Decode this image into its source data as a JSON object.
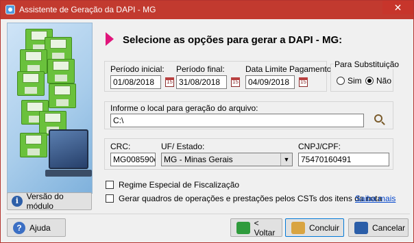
{
  "window": {
    "title": "Assistente de Geração da DAPI - MG",
    "close_symbol": "✕"
  },
  "heading": "Selecione as opções para gerar a DAPI - MG:",
  "periodo": {
    "inicial_label": "Período inicial:",
    "inicial_value": "01/08/2018",
    "final_label": "Período final:",
    "final_value": "31/08/2018",
    "limite_label": "Data Limite Pagamento:",
    "limite_value": "04/09/2018"
  },
  "substituicao": {
    "legend": "Para Substituição",
    "options": [
      {
        "label": "Sim",
        "checked": false
      },
      {
        "label": "Não",
        "checked": true
      }
    ]
  },
  "arquivo": {
    "label": "Informe o local para geração do arquivo:",
    "value": "C:\\"
  },
  "empresa": {
    "crc_label": "CRC:",
    "crc_value": "MG008590o",
    "uf_label": "UF/ Estado:",
    "uf_value": "MG - Minas Gerais",
    "cnpj_label": "CNPJ/CPF:",
    "cnpj_value": "75470160491"
  },
  "checks": [
    {
      "label": "Regime Especial de Fiscalização",
      "checked": false
    },
    {
      "label": "Gerar quadros de operações e prestações pelos CSTs dos itens da nota",
      "checked": false
    }
  ],
  "saiba_mais": "Saiba mais",
  "buttons": {
    "versao": "Versão do módulo",
    "ajuda": "Ajuda",
    "voltar": "< Voltar",
    "concluir": "Concluir",
    "cancelar": "Cancelar"
  },
  "colors": {
    "titlebar": "#c23a2f",
    "accent_arrow": "#e0157b",
    "link": "#0044cc"
  }
}
